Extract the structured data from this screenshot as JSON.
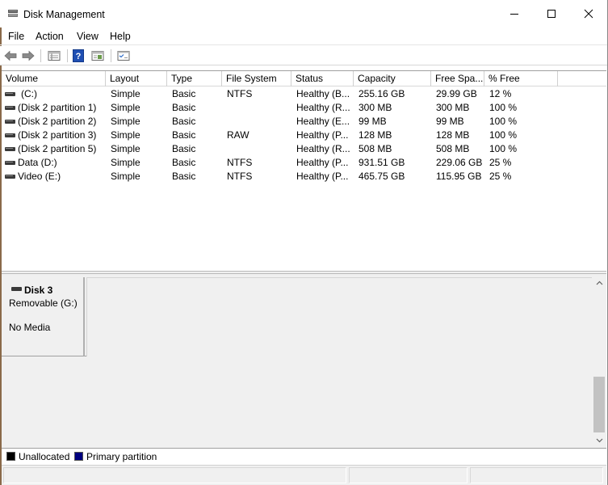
{
  "window": {
    "title": "Disk Management"
  },
  "menu": {
    "items": [
      "File",
      "Action",
      "View",
      "Help"
    ]
  },
  "toolbar": {
    "buttons": [
      "back-icon",
      "forward-icon",
      "disk-list-icon",
      "help-icon",
      "properties-icon",
      "console-icon"
    ]
  },
  "volumes": {
    "columns": [
      "Volume",
      "Layout",
      "Type",
      "File System",
      "Status",
      "Capacity",
      "Free Spa...",
      "% Free"
    ],
    "rows": [
      {
        "volume": "(C:)",
        "layout": "Simple",
        "type": "Basic",
        "fs": "NTFS",
        "status": "Healthy (B...",
        "capacity": "255.16 GB",
        "free": "29.99 GB",
        "pct": "12 %"
      },
      {
        "volume": "(Disk 2 partition 1)",
        "layout": "Simple",
        "type": "Basic",
        "fs": "",
        "status": "Healthy (R...",
        "capacity": "300 MB",
        "free": "300 MB",
        "pct": "100 %"
      },
      {
        "volume": "(Disk 2 partition 2)",
        "layout": "Simple",
        "type": "Basic",
        "fs": "",
        "status": "Healthy (E...",
        "capacity": "99 MB",
        "free": "99 MB",
        "pct": "100 %"
      },
      {
        "volume": "(Disk 2 partition 3)",
        "layout": "Simple",
        "type": "Basic",
        "fs": "RAW",
        "status": "Healthy (P...",
        "capacity": "128 MB",
        "free": "128 MB",
        "pct": "100 %"
      },
      {
        "volume": "(Disk 2 partition 5)",
        "layout": "Simple",
        "type": "Basic",
        "fs": "",
        "status": "Healthy (R...",
        "capacity": "508 MB",
        "free": "508 MB",
        "pct": "100 %"
      },
      {
        "volume": "Data (D:)",
        "layout": "Simple",
        "type": "Basic",
        "fs": "NTFS",
        "status": "Healthy (P...",
        "capacity": "931.51 GB",
        "free": "229.06 GB",
        "pct": "25 %"
      },
      {
        "volume": "Video (E:)",
        "layout": "Simple",
        "type": "Basic",
        "fs": "NTFS",
        "status": "Healthy (P...",
        "capacity": "465.75 GB",
        "free": "115.95 GB",
        "pct": "25 %"
      }
    ]
  },
  "disk": {
    "name": "Disk 3",
    "type": "Removable (G:)",
    "media": "No Media"
  },
  "legend": {
    "items": [
      {
        "label": "Unallocated",
        "color": "#000000"
      },
      {
        "label": "Primary partition",
        "color": "#00007f"
      }
    ]
  }
}
